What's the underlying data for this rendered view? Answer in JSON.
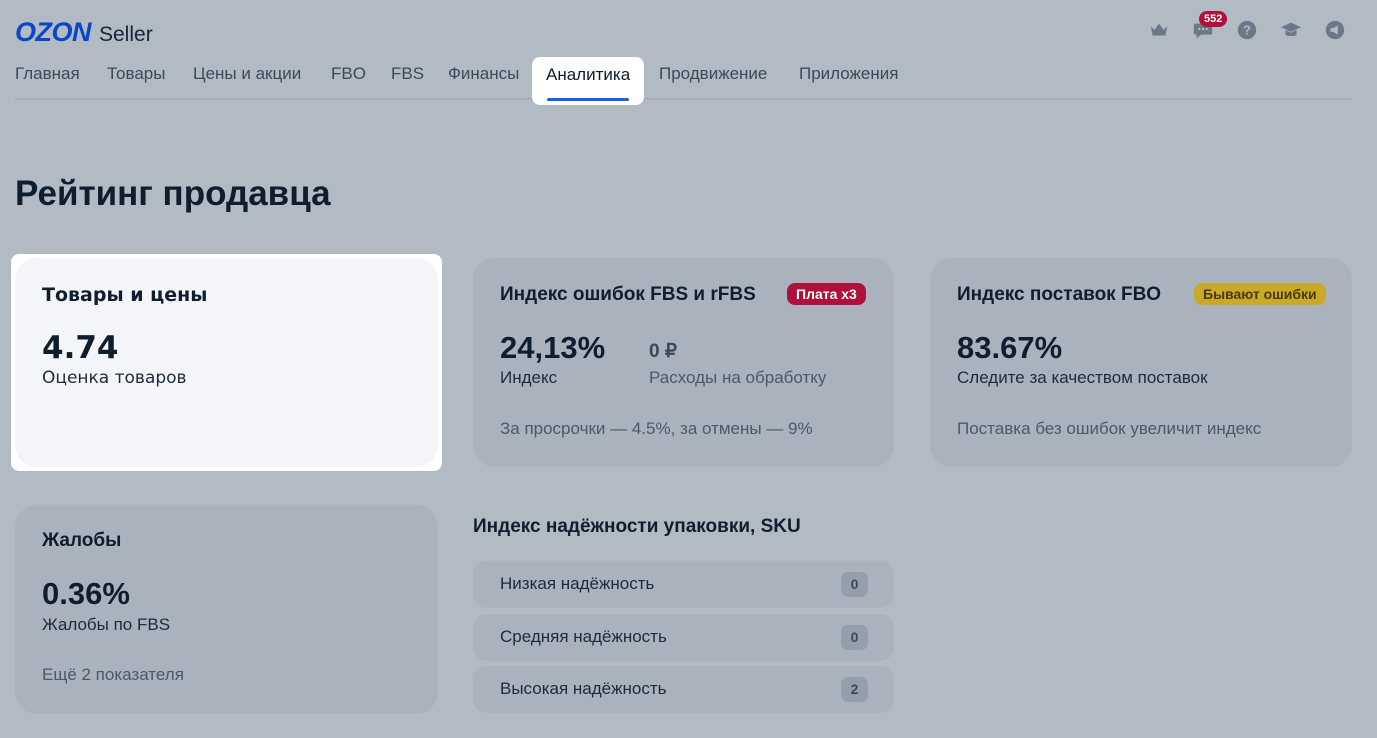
{
  "brand": {
    "logo_text": "OZON",
    "product": "Seller"
  },
  "header": {
    "chat_badge": "552",
    "icons": [
      "crown-icon",
      "chat-icon",
      "help-icon",
      "education-icon",
      "megaphone-icon"
    ]
  },
  "nav": {
    "items": [
      {
        "label": "Главная"
      },
      {
        "label": "Товары"
      },
      {
        "label": "Цены и акции"
      },
      {
        "label": "FBO"
      },
      {
        "label": "FBS"
      },
      {
        "label": "Финансы"
      },
      {
        "label": "Аналитика",
        "active": true
      },
      {
        "label": "Продвижение"
      },
      {
        "label": "Приложения"
      }
    ]
  },
  "page": {
    "title": "Рейтинг продавца"
  },
  "cards": {
    "products": {
      "title": "Товары и цены",
      "value": "4.74",
      "subtitle": "Оценка товаров"
    },
    "fbs_errors": {
      "title": "Индекс ошибок FBS и rFBS",
      "badge": "Плата x3",
      "value": "24,13%",
      "value_label": "Индекс",
      "cost": "0 ₽",
      "cost_label": "Расходы на обработку",
      "note": "За просрочки — 4.5%, за отмены — 9%"
    },
    "fbo_supply": {
      "title": "Индекс поставок FBO",
      "badge": "Бывают ошибки",
      "value": "83.67%",
      "subtitle": "Следите за качеством поставок",
      "note": "Поставка без ошибок увеличит индекс"
    },
    "complaints": {
      "title": "Жалобы",
      "value": "0.36%",
      "subtitle": "Жалобы по FBS",
      "note": "Ещё 2 показателя"
    }
  },
  "packaging": {
    "title": "Индекс надёжности упаковки, SKU",
    "rows": [
      {
        "label": "Низкая надёжность",
        "count": "0"
      },
      {
        "label": "Средняя надёжность",
        "count": "0"
      },
      {
        "label": "Высокая надёжность",
        "count": "2"
      }
    ]
  },
  "colors": {
    "brand_blue": "#0a46c8",
    "badge_red": "#b0103c",
    "badge_yellow": "#c9a928",
    "active_underline": "#1a5eea"
  }
}
